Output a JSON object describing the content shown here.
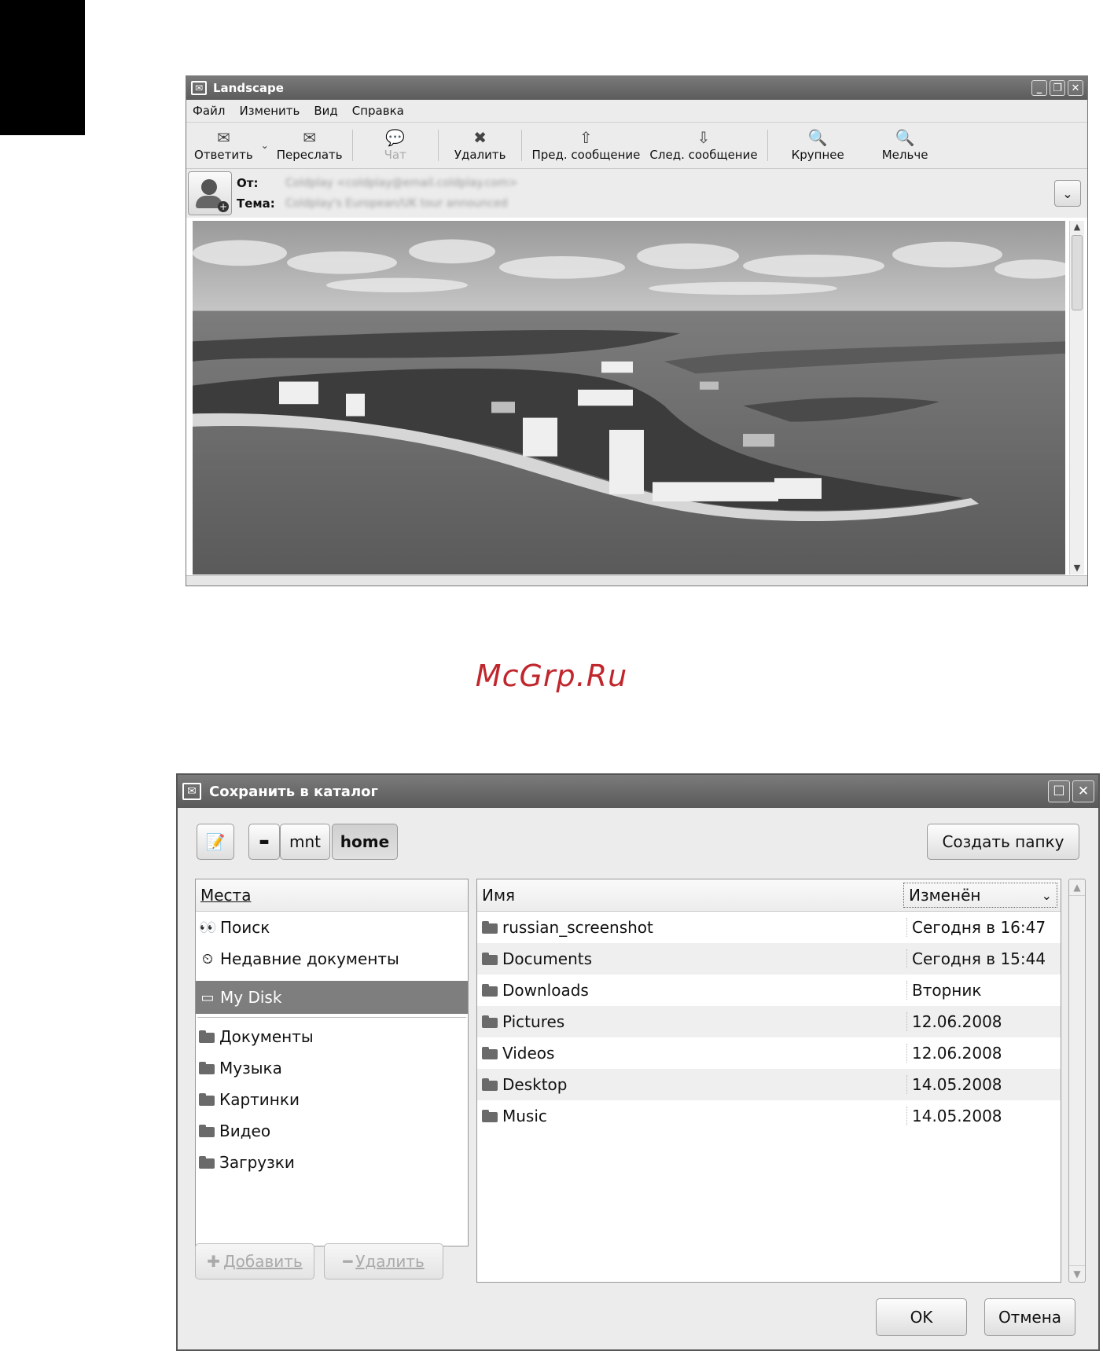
{
  "mail_window": {
    "title": "Landscape",
    "menu": [
      "Файл",
      "Изменить",
      "Вид",
      "Справка"
    ],
    "toolbar": {
      "reply": "Ответить",
      "forward": "Переслать",
      "chat": "Чат",
      "delete": "Удалить",
      "prev": "Пред. сообщение",
      "next": "След. сообщение",
      "zoom_in": "Крупнее",
      "zoom_out": "Мельче"
    },
    "header": {
      "from_label": "От:",
      "from_value": "Coldplay <coldplay@email.coldplay.com>",
      "subject_label": "Тема:",
      "subject_value": "Coldplay's European/UK tour announced"
    }
  },
  "watermark": "McGrp.Ru",
  "save_dialog": {
    "title": "Сохранить в каталог",
    "path": [
      "mnt",
      "home"
    ],
    "create_folder": "Создать папку",
    "places_header": "Места",
    "places": [
      {
        "label": "Поиск",
        "icon": "binoculars-icon"
      },
      {
        "label": "Недавние документы",
        "icon": "recent-icon"
      },
      {
        "label": "My Disk",
        "icon": "disk-icon"
      }
    ],
    "bookmarks": [
      "Документы",
      "Музыка",
      "Картинки",
      "Видео",
      "Загрузки"
    ],
    "add_button": "Добавить",
    "remove_button": "Удалить",
    "columns": {
      "name": "Имя",
      "modified": "Изменён"
    },
    "files": [
      {
        "name": "russian_screenshot",
        "modified": "Сегодня в 16:47"
      },
      {
        "name": "Documents",
        "modified": "Сегодня в 15:44"
      },
      {
        "name": "Downloads",
        "modified": "Вторник"
      },
      {
        "name": "Pictures",
        "modified": "12.06.2008"
      },
      {
        "name": "Videos",
        "modified": "12.06.2008"
      },
      {
        "name": "Desktop",
        "modified": "14.05.2008"
      },
      {
        "name": "Music",
        "modified": "14.05.2008"
      }
    ],
    "ok": "OK",
    "cancel": "Отмена"
  }
}
